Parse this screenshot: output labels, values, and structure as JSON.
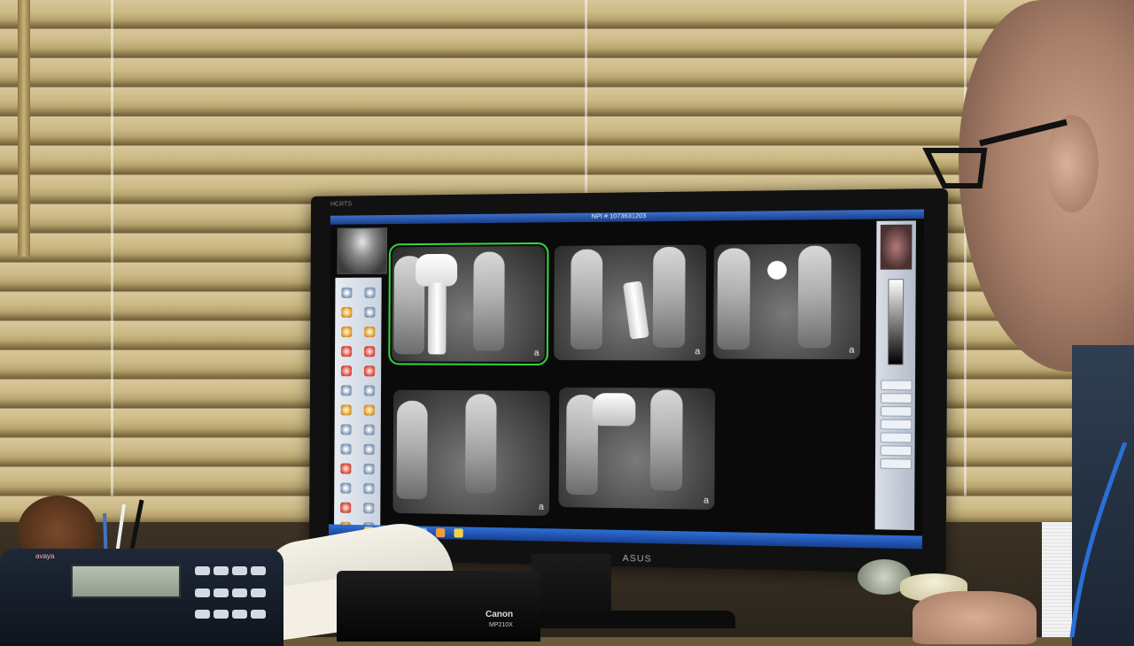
{
  "monitor": {
    "corner_label": "HCRTS",
    "brand": "ASUS"
  },
  "app": {
    "title": "NPI # 1073631203"
  },
  "xrays": [
    {
      "label": "a"
    },
    {
      "label": "a"
    },
    {
      "label": "a"
    },
    {
      "label": "a"
    },
    {
      "label": "a"
    }
  ],
  "desk": {
    "phone_brand": "avaya",
    "printer_brand": "Canon",
    "printer_model": "MP210X"
  },
  "colors": {
    "selection": "#33d63a",
    "taskbar": "#2f6fd6"
  }
}
